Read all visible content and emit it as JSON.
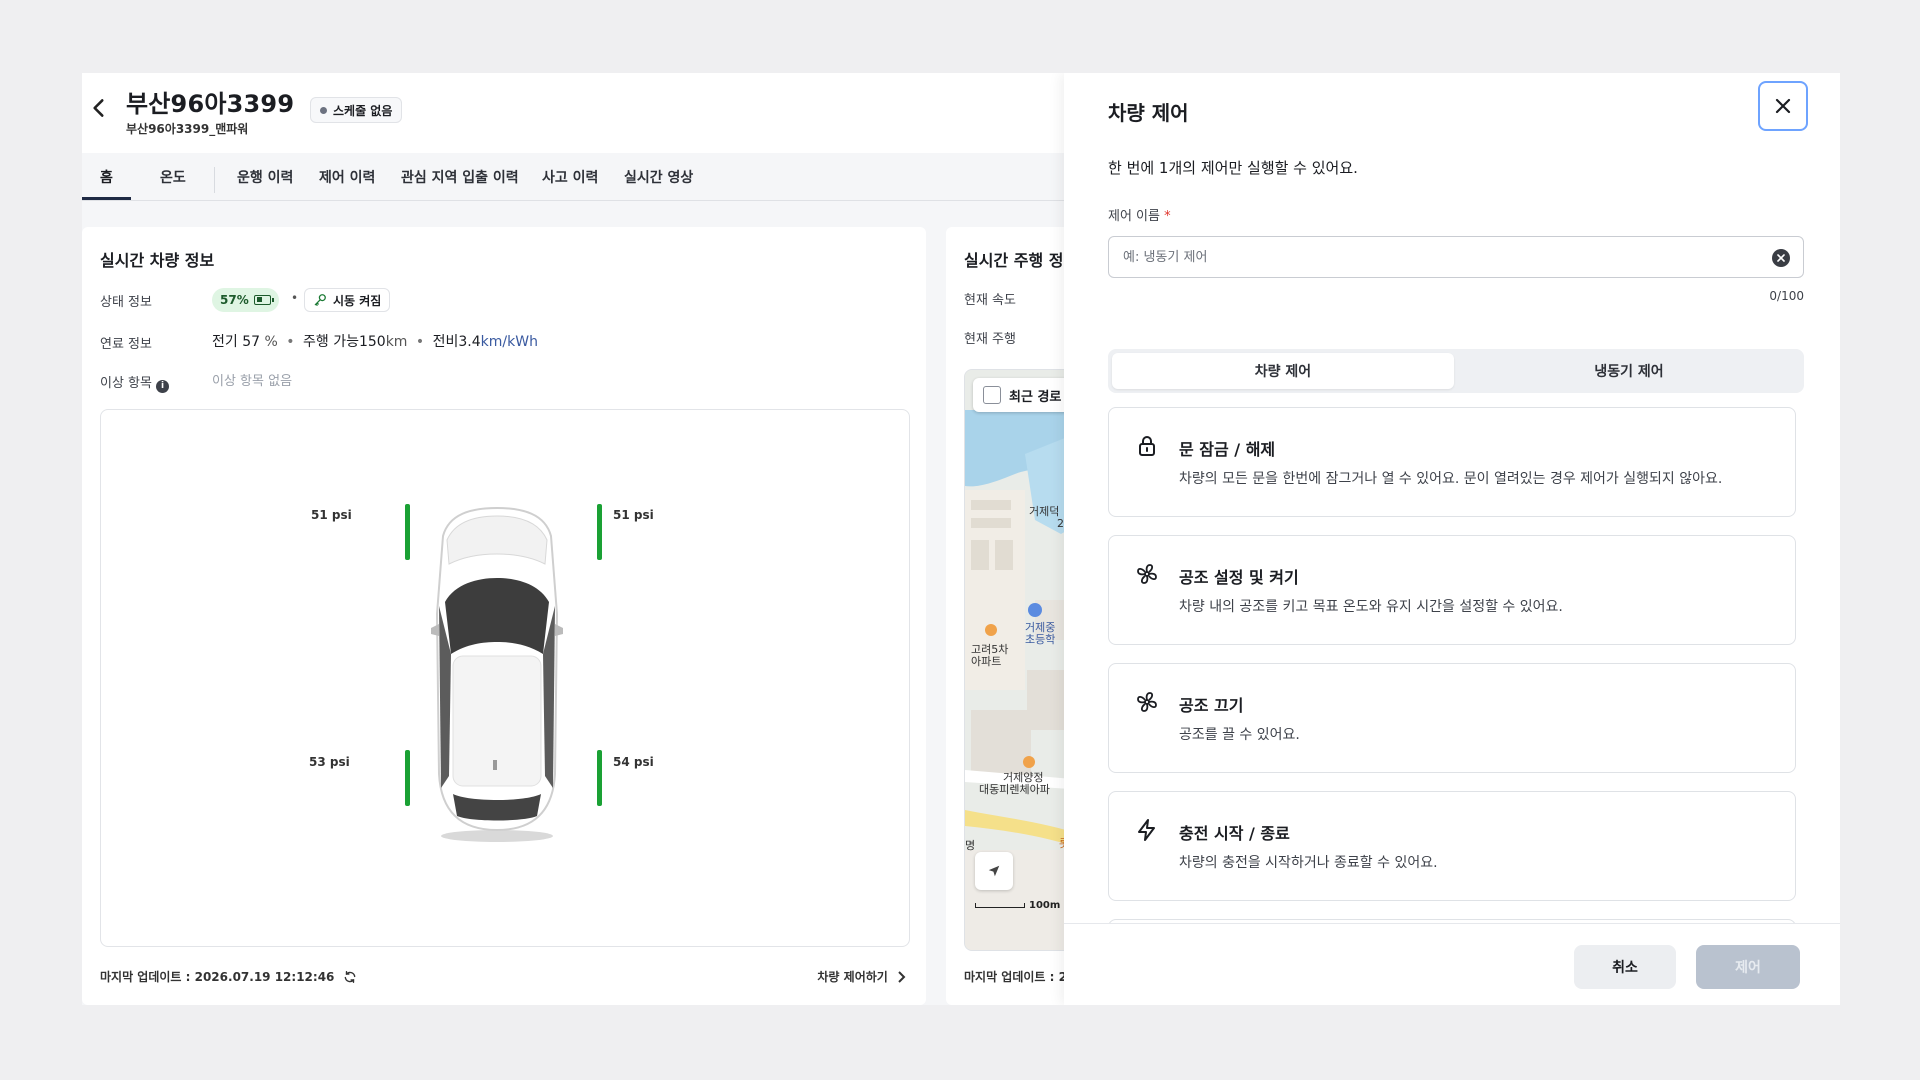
{
  "header": {
    "title": "부산96아3399",
    "subtitle": "부산96아3399_맨파워",
    "schedule_badge": "스케줄 없음"
  },
  "tabs": [
    {
      "label": "홈",
      "active": true
    },
    {
      "label": "온도"
    },
    {
      "label": "운행 이력"
    },
    {
      "label": "제어 이력"
    },
    {
      "label": "관심 지역 입출 이력"
    },
    {
      "label": "사고 이력"
    },
    {
      "label": "실시간 영상"
    }
  ],
  "vehicle_info": {
    "title": "실시간 차량 정보",
    "status_label": "상태 정보",
    "battery_percent": "57%",
    "engine_status": "시동 켜짐",
    "fuel_label": "연료 정보",
    "fuel_electric_prefix": "전기",
    "fuel_electric_value": "57",
    "fuel_electric_unit": "%",
    "fuel_range_prefix": "주행 가능",
    "fuel_range_value": "150",
    "fuel_range_unit": "km",
    "fuel_efficiency_prefix": "전비",
    "fuel_efficiency_value": "3.4",
    "fuel_efficiency_unit": "km/kWh",
    "anomaly_label": "이상 항목",
    "anomaly_value": "이상 항목 없음",
    "tires": {
      "front_left": "51 psi",
      "front_right": "51 psi",
      "rear_left": "53 psi",
      "rear_right": "54 psi"
    },
    "last_update": "마지막 업데이트 : 2026.07.19 12:12:46",
    "control_link": "차량 제어하기"
  },
  "driving_info": {
    "title": "실시간 주행 정!",
    "speed_label": "현재 속도",
    "driving_label": "현재 주행",
    "recent_route_checkbox": "최근 경로",
    "map_labels": {
      "l1": "거제덕",
      "l1b": "2",
      "l2": "거제중",
      "l2b": "초등학",
      "l3": "고려5차",
      "l3b": "아파트",
      "l4": "거제양정",
      "l4b": "대동피렌체아파",
      "l5": "롯",
      "l6": "명"
    },
    "scale": "100m",
    "last_update": "마지막 업데이트 : 2"
  },
  "drawer": {
    "title": "차량 제어",
    "description": "한 번에 1개의 제어만 실행할 수 있어요.",
    "field_label": "제어 이름",
    "field_required": "*",
    "field_value": "",
    "field_placeholder": "예: 냉동기 제어",
    "counter": "0/100",
    "segments": [
      {
        "label": "차량 제어",
        "active": true
      },
      {
        "label": "냉동기 제어"
      }
    ],
    "options": [
      {
        "icon": "lock-icon",
        "title": "문 잠금 / 해제",
        "desc": "차량의 모든 문을 한번에 잠그거나 열 수 있어요. 문이 열려있는 경우 제어가 실행되지 않아요."
      },
      {
        "icon": "fan-icon",
        "title": "공조 설정 및 켜기",
        "desc": "차량 내의 공조를 키고 목표 온도와 유지 시간을 설정할 수 있어요."
      },
      {
        "icon": "fan-icon",
        "title": "공조 끄기",
        "desc": "공조를 끌 수 있어요."
      },
      {
        "icon": "lightning-icon",
        "title": "충전 시작 / 종료",
        "desc": "차량의 충전을 시작하거나 종료할 수 있어요."
      }
    ],
    "cancel_label": "취소",
    "submit_label": "제어"
  },
  "colors": {
    "accent_focus": "#6ea3ff",
    "tire_ok": "#1aa134",
    "battery_bg": "#dff5e3",
    "submit_disabled": "#b9c2cf"
  }
}
